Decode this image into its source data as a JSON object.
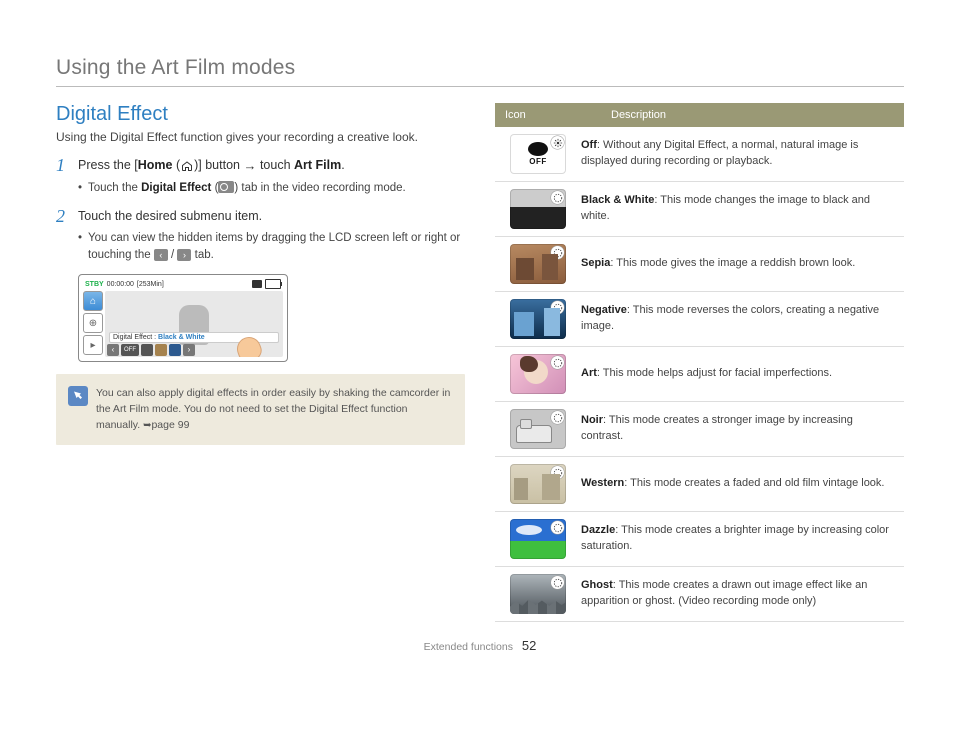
{
  "page_title": "Using the Art Film modes",
  "section_title": "Digital Effect",
  "intro": "Using the Digital Effect function gives your recording a creative look.",
  "step1": {
    "pre": "Press the [",
    "home_bold": "Home",
    "mid": " (",
    "post_icon": ")] button ",
    "arrow": "→",
    "touch": " touch ",
    "artfilm_bold": "Art Film",
    "end": "."
  },
  "step1_bullet": {
    "pre": "Touch the ",
    "bold": "Digital Effect",
    "mid": " (",
    "post": ") tab in the video recording mode."
  },
  "step2": "Touch the desired submenu item.",
  "step2_bullet": {
    "l1": "You can view the hidden items by dragging the LCD screen left or right or touching the ",
    "sep": " / ",
    "l2": " tab."
  },
  "lcd": {
    "stby": "STBY",
    "time": "00:00:00",
    "remain": "[253Min]",
    "bar_label": "Digital Effect : ",
    "bar_value": "Black & White",
    "off": "OFF"
  },
  "tip": "You can also apply digital effects in order easily by shaking the camcorder in the Art Film mode. You do not need to set the Digital Effect function manually. ",
  "tip_page": "page 99",
  "table": {
    "h1": "Icon",
    "h2": "Description",
    "rows": [
      {
        "name": "Off",
        "desc": ": Without any Digital Effect, a normal, natural image is displayed during recording or playback."
      },
      {
        "name": "Black & White",
        "desc": ": This mode changes the image to black and white."
      },
      {
        "name": "Sepia",
        "desc": ": This mode gives the image a reddish brown look."
      },
      {
        "name": "Negative",
        "desc": ": This mode reverses the colors, creating a negative image."
      },
      {
        "name": "Art",
        "desc": ": This mode helps adjust for facial imperfections."
      },
      {
        "name": "Noir",
        "desc": ": This mode creates a stronger image by increasing contrast."
      },
      {
        "name": "Western",
        "desc": ": This mode creates a faded and old film vintage look."
      },
      {
        "name": "Dazzle",
        "desc": ": This mode creates a brighter image by increasing color saturation."
      },
      {
        "name": "Ghost",
        "desc": ": This mode creates a drawn out image effect like an apparition or ghost. (Video recording mode only)"
      }
    ]
  },
  "footer_section": "Extended functions",
  "footer_page": "52"
}
